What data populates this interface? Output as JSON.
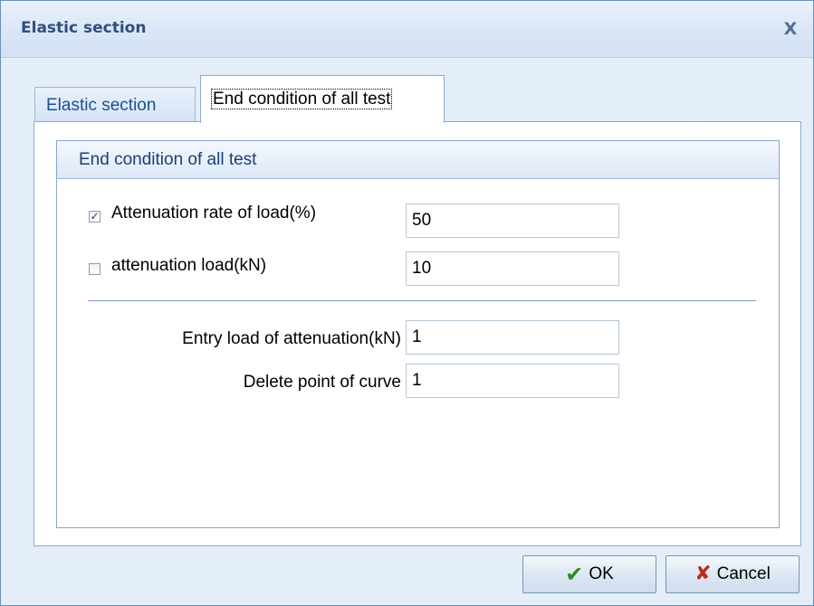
{
  "window": {
    "title": "Elastic section",
    "close_glyph": "X"
  },
  "tabs": [
    {
      "label": "Elastic section",
      "active": false
    },
    {
      "label": "End condition of all test",
      "active": true
    }
  ],
  "group": {
    "title": "End condition of all test",
    "attenuation_rate": {
      "label": "Attenuation rate of load(%)",
      "checked": true,
      "check_glyph": "✓",
      "value": "50"
    },
    "attenuation_load": {
      "label": "attenuation load(kN)",
      "checked": false,
      "value": "10"
    },
    "entry_load": {
      "label": "Entry load of attenuation(kN)",
      "value": "1"
    },
    "delete_point": {
      "label": "Delete point of curve",
      "value": "1"
    }
  },
  "buttons": {
    "ok": {
      "label": "OK",
      "icon": "checkmark-icon",
      "glyph": "✔",
      "color": "#2e8b1a"
    },
    "cancel": {
      "label": "Cancel",
      "icon": "x-icon",
      "glyph": "✘",
      "color": "#c0281c"
    }
  }
}
